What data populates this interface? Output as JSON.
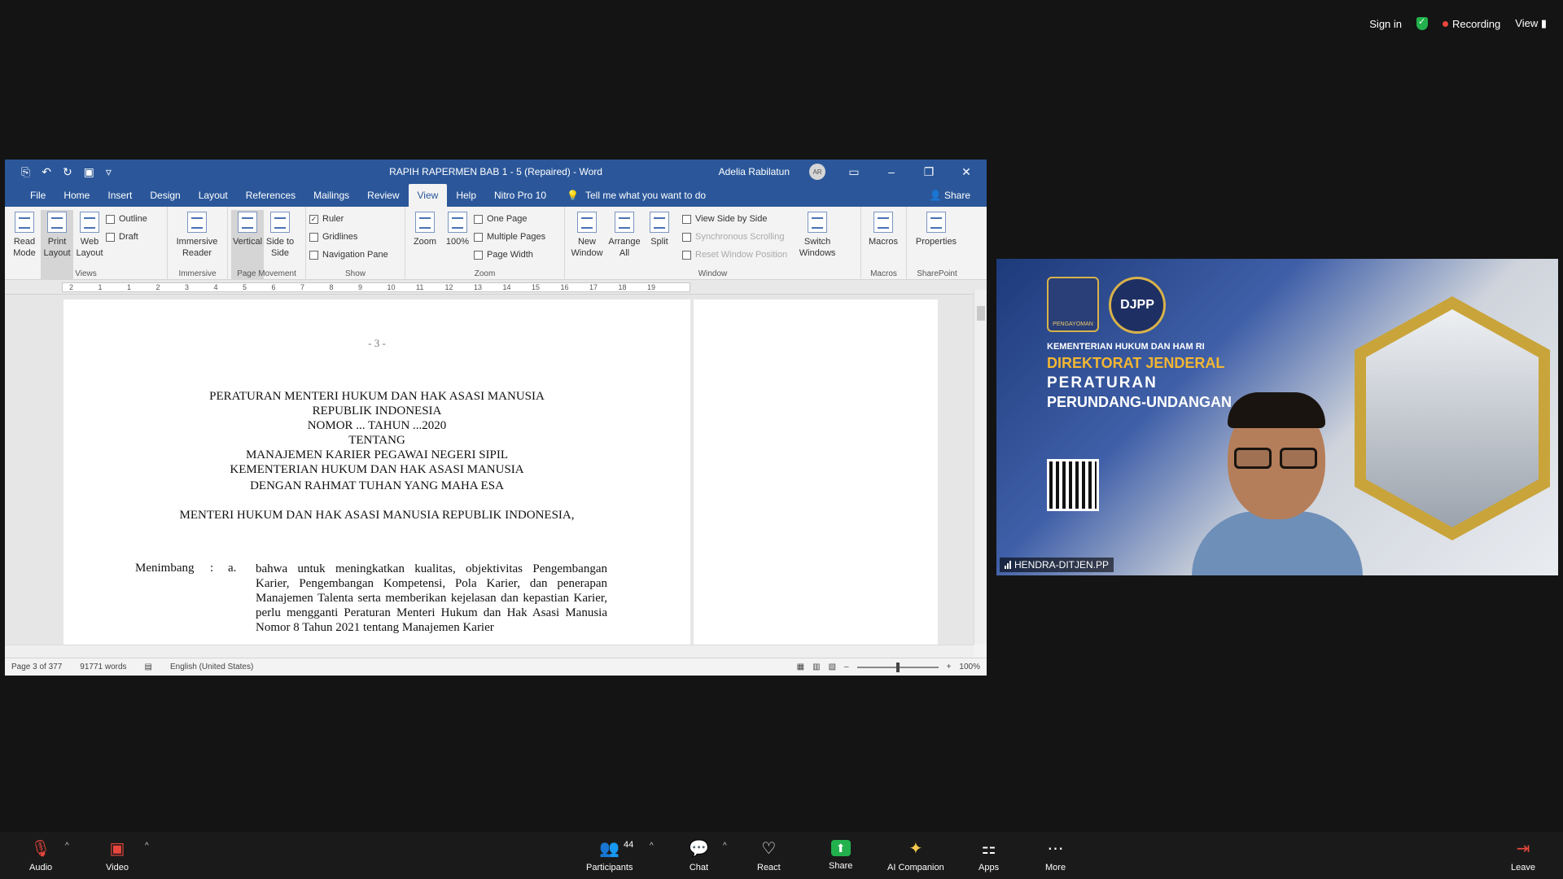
{
  "top_right": {
    "sign_in": "Sign in",
    "recording": "Recording",
    "view": "View"
  },
  "word": {
    "title": "RAPIH RAPERMEN BAB 1 - 5 (Repaired)  -  Word",
    "user": "Adelia Rabilatun",
    "user_initials": "AR",
    "tabs": [
      "File",
      "Home",
      "Insert",
      "Design",
      "Layout",
      "References",
      "Mailings",
      "Review",
      "View",
      "Help",
      "Nitro Pro 10"
    ],
    "active_tab": "View",
    "tell_me": "Tell me what you want to do",
    "share": "Share",
    "ribbon": {
      "views": {
        "label": "Views",
        "read_mode": "Read Mode",
        "print_layout": "Print Layout",
        "web_layout": "Web Layout",
        "outline": "Outline",
        "draft": "Draft"
      },
      "immersive": {
        "label": "Immersive",
        "reader": "Immersive Reader"
      },
      "page_movement": {
        "label": "Page Movement",
        "vertical": "Vertical",
        "side": "Side to Side"
      },
      "show": {
        "label": "Show",
        "ruler": "Ruler",
        "gridlines": "Gridlines",
        "nav": "Navigation Pane"
      },
      "zoom": {
        "label": "Zoom",
        "zoom": "Zoom",
        "pct": "100%",
        "one_page": "One Page",
        "multiple": "Multiple Pages",
        "width": "Page Width"
      },
      "window": {
        "label": "Window",
        "new": "New Window",
        "arrange": "Arrange All",
        "split": "Split",
        "side_by_side": "View Side by Side",
        "sync": "Synchronous Scrolling",
        "reset": "Reset Window Position",
        "switch": "Switch Windows"
      },
      "macros": {
        "label": "Macros",
        "macros": "Macros"
      },
      "sharepoint": {
        "label": "SharePoint",
        "properties": "Properties"
      }
    },
    "ruler_nums": [
      "2",
      "1",
      "1",
      "2",
      "3",
      "4",
      "5",
      "6",
      "7",
      "8",
      "9",
      "10",
      "11",
      "12",
      "13",
      "14",
      "15",
      "16",
      "17",
      "18",
      "19"
    ],
    "doc": {
      "page_num": "- 3 -",
      "heading": [
        "PERATURAN MENTERI HUKUM DAN HAK ASASI MANUSIA",
        "REPUBLIK INDONESIA",
        "NOMOR ... TAHUN ...2020",
        "TENTANG",
        "MANAJEMEN KARIER PEGAWAI NEGERI SIPIL",
        "KEMENTERIAN HUKUM DAN HAK ASASI MANUSIA"
      ],
      "rahmat": "DENGAN RAHMAT TUHAN YANG MAHA ESA",
      "menteri": "MENTERI HUKUM DAN HAK ASASI MANUSIA REPUBLIK INDONESIA,",
      "menimbang_label": "Menimbang",
      "colon": ":",
      "letter": "a.",
      "menimbang_text": "bahwa untuk meningkatkan kualitas, objektivitas Pengembangan Karier, Pengembangan Kompetensi, Pola Karier, dan penerapan Manajemen Talenta serta memberikan kejelasan dan kepastian Karier, perlu mengganti Peraturan Menteri Hukum dan Hak Asasi Manusia Nomor 8 Tahun 2021 tentang Manajemen Karier"
    },
    "status": {
      "page": "Page 3 of 377",
      "words": "91771 words",
      "lang": "English (United States)",
      "zoom": "100%"
    }
  },
  "video": {
    "ministry": "KEMENTERIAN HUKUM DAN HAM RI",
    "dj": "DIREKTORAT JENDERAL",
    "per": "PERATURAN",
    "pu": "PERUNDANG-UNDANGAN",
    "logo2": "DJPP",
    "logo1": "PENGAYOMAN",
    "participant": "HENDRA-DITJEN.PP"
  },
  "toolbar": {
    "audio": "Audio",
    "video": "Video",
    "participants": "Participants",
    "participants_count": "44",
    "chat": "Chat",
    "react": "React",
    "share": "Share",
    "ai": "AI Companion",
    "apps": "Apps",
    "more": "More",
    "leave": "Leave"
  }
}
